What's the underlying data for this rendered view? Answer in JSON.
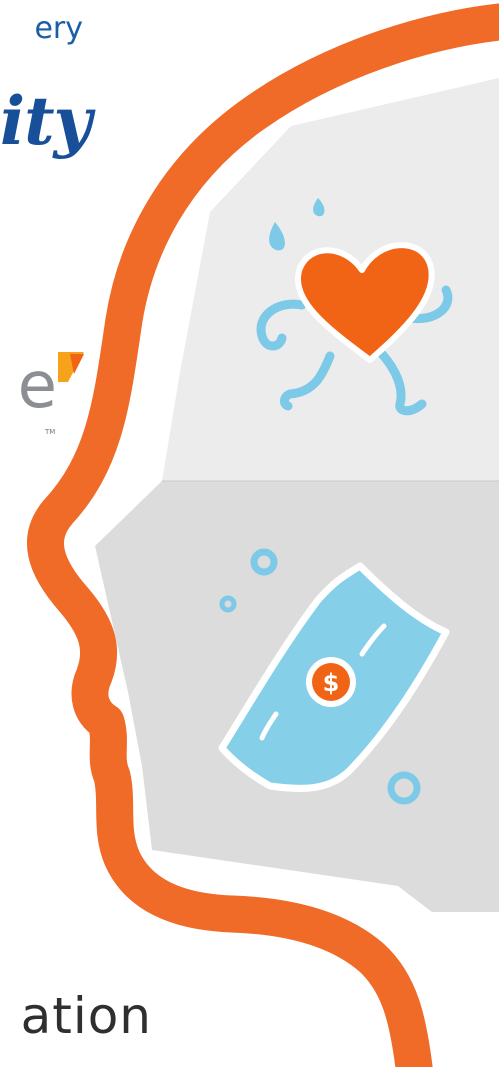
{
  "text": {
    "top_fragment": "ery",
    "script_fragment": "ity",
    "logo_fragment": "e",
    "logo_tm": "TM",
    "bottom_fragment": "ation"
  },
  "colors": {
    "head_outline": "#f06a28",
    "upper_panel": "#ececec",
    "lower_panel": "#dcdcdc",
    "heart": "#f26415",
    "light_blue": "#7cc9e8",
    "money": "#86cfe8",
    "brand_blue": "#1b5ea7",
    "logo_gray": "#8b8f94",
    "logo_accent": "#f7a21b",
    "dark_text": "#2f2f2f"
  },
  "icons": {
    "upper": "running-heart-icon",
    "lower": "dollar-bill-icon"
  }
}
